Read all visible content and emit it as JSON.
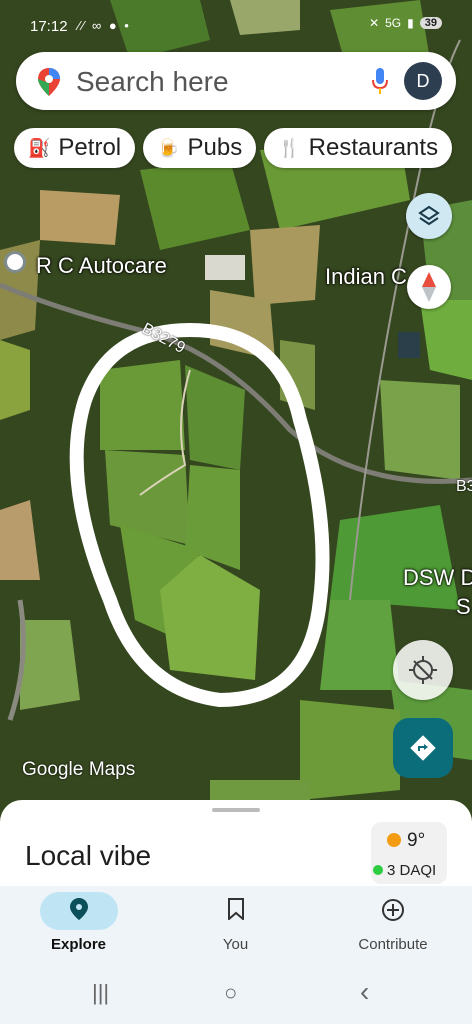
{
  "status_bar": {
    "time": "17:12",
    "left_icons": "⁄⁄ ∞ ● •",
    "network": "5G",
    "battery": "39"
  },
  "search": {
    "placeholder": "Search here",
    "avatar_letter": "D"
  },
  "chips": [
    {
      "label": "Petrol",
      "icon": "fuel-icon"
    },
    {
      "label": "Pubs",
      "icon": "beer-icon"
    },
    {
      "label": "Restaurants",
      "icon": "fork-knife-icon"
    }
  ],
  "map": {
    "labels": {
      "rc_autocare": "R C Autocare",
      "indian": "Indian C",
      "dsw": "DSW D",
      "dsw2": "S"
    },
    "roads": {
      "b3279": "B3279",
      "b3": "B3"
    },
    "logo_google": "Google",
    "logo_maps": "Maps"
  },
  "sheet": {
    "title": "Local vibe",
    "weather_temp": "9°",
    "air_quality": "3 DAQI"
  },
  "nav": [
    {
      "label": "Explore",
      "icon": "explore-pin-icon",
      "active": true
    },
    {
      "label": "You",
      "icon": "bookmark-icon",
      "active": false
    },
    {
      "label": "Contribute",
      "icon": "plus-circle-icon",
      "active": false
    }
  ],
  "system_nav": {
    "recents": "|||",
    "home": "○",
    "back": "‹"
  },
  "colors": {
    "directions": "#0b6d7a",
    "layers_bg": "#cfe8f2",
    "nav_active": "#bfe5f4"
  }
}
